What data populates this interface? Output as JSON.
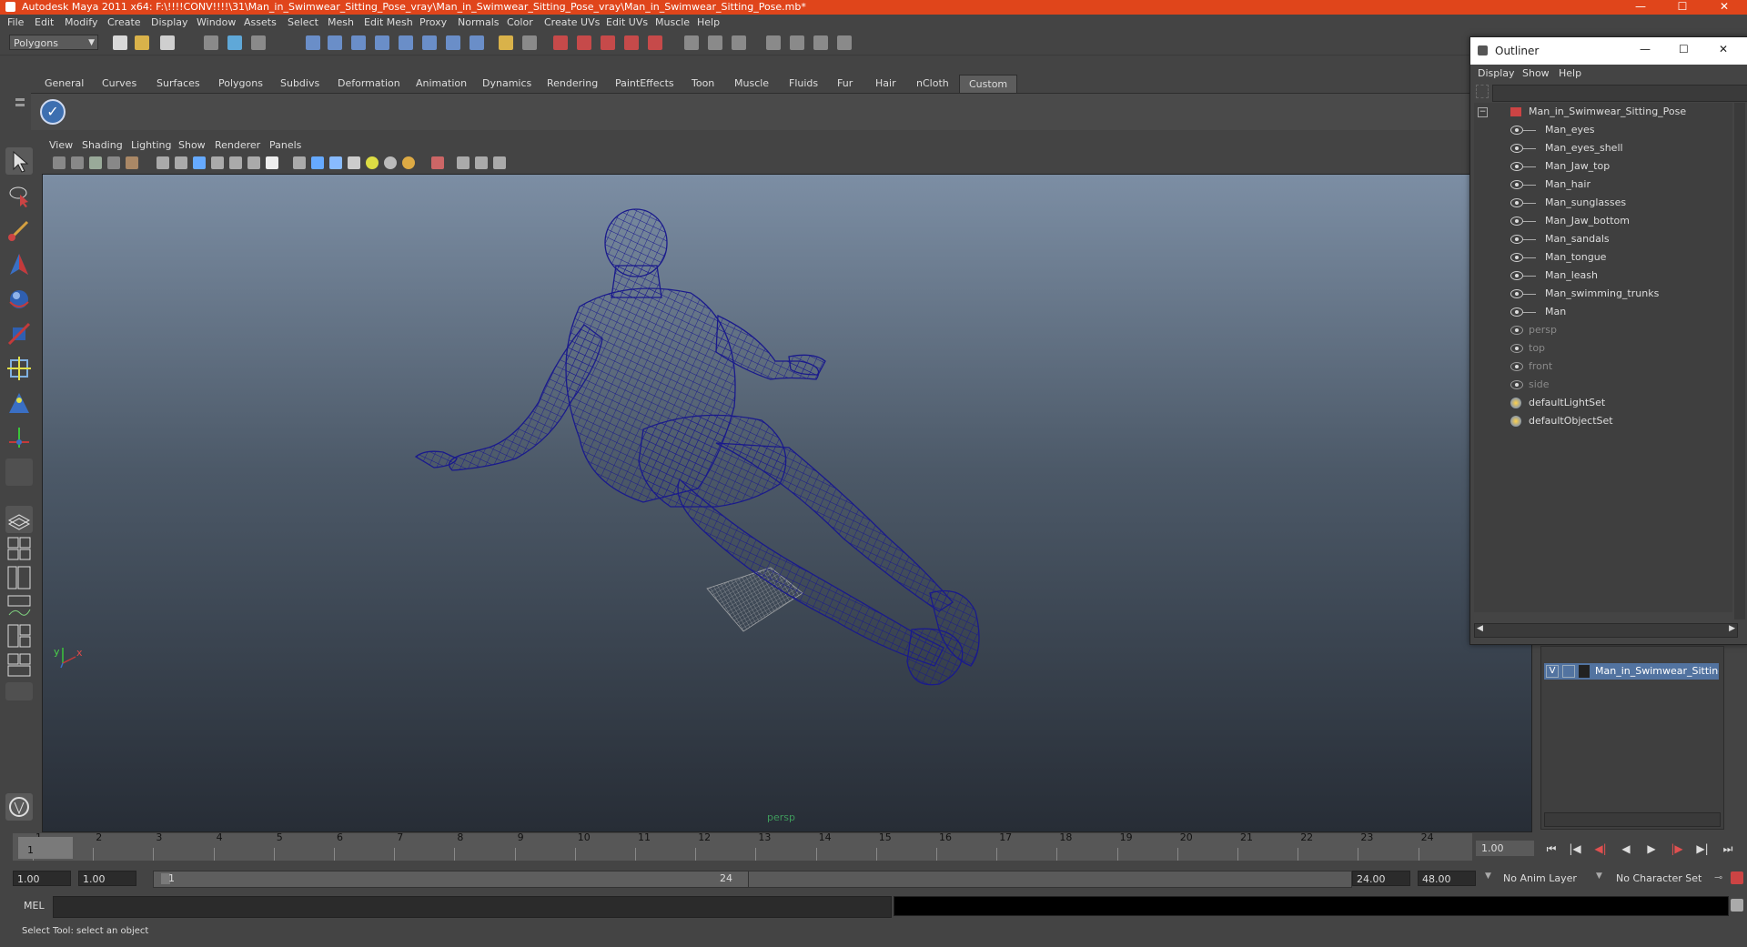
{
  "window": {
    "title": "Autodesk Maya 2011 x64: F:\\!!!!CONV!!!!\\31\\Man_in_Swimwear_Sitting_Pose_vray\\Man_in_Swimwear_Sitting_Pose_vray\\Man_in_Swimwear_Sitting_Pose.mb*",
    "minimize": "—",
    "maximize": "☐",
    "close": "✕"
  },
  "menubar": [
    "File",
    "Edit",
    "Modify",
    "Create",
    "Display",
    "Window",
    "Assets",
    "Select",
    "Mesh",
    "Edit Mesh",
    "Proxy",
    "Normals",
    "Color",
    "Create UVs",
    "Edit UVs",
    "Muscle",
    "Help"
  ],
  "toolbar": {
    "mode": "Polygons"
  },
  "shelf_tabs": [
    "General",
    "Curves",
    "Surfaces",
    "Polygons",
    "Subdivs",
    "Deformation",
    "Animation",
    "Dynamics",
    "Rendering",
    "PaintEffects",
    "Toon",
    "Muscle",
    "Fluids",
    "Fur",
    "Hair",
    "nCloth",
    "Custom"
  ],
  "shelf_active": "Custom",
  "viewport": {
    "menus": [
      "View",
      "Shading",
      "Lighting",
      "Show",
      "Renderer",
      "Panels"
    ],
    "camera_label": "persp",
    "axis_x": "x",
    "axis_y": "y",
    "wire_color": "#1a1a8c"
  },
  "timeline": {
    "ticks": [
      "1",
      "2",
      "3",
      "4",
      "5",
      "6",
      "7",
      "8",
      "9",
      "10",
      "11",
      "12",
      "13",
      "14",
      "15",
      "16",
      "17",
      "18",
      "19",
      "20",
      "21",
      "22",
      "23",
      "24"
    ],
    "current_frame": "1",
    "playback_field": "1.00"
  },
  "range": {
    "start": "1.00",
    "start2": "1.00",
    "slider_start": "1",
    "slider_end": "24",
    "end": "24.00",
    "end2": "48.00",
    "anim_layer": "No Anim Layer",
    "char_set": "No Character Set"
  },
  "command": {
    "label": "MEL"
  },
  "status": {
    "help_text": "Select Tool: select an object"
  },
  "outliner": {
    "title": "Outliner",
    "menus": [
      "Display",
      "Show",
      "Help"
    ],
    "root": "Man_in_Swimwear_Sitting_Pose",
    "children": [
      "Man_eyes",
      "Man_eyes_shell",
      "Man_Jaw_top",
      "Man_hair",
      "Man_sunglasses",
      "Man_Jaw_bottom",
      "Man_sandals",
      "Man_tongue",
      "Man_leash",
      "Man_swimming_trunks",
      "Man"
    ],
    "cameras": [
      "persp",
      "top",
      "front",
      "side"
    ],
    "sets": [
      "defaultLightSet",
      "defaultObjectSet"
    ]
  },
  "layers": {
    "visible_flag": "V",
    "layer_name": "Man_in_Swimwear_Sitting"
  }
}
